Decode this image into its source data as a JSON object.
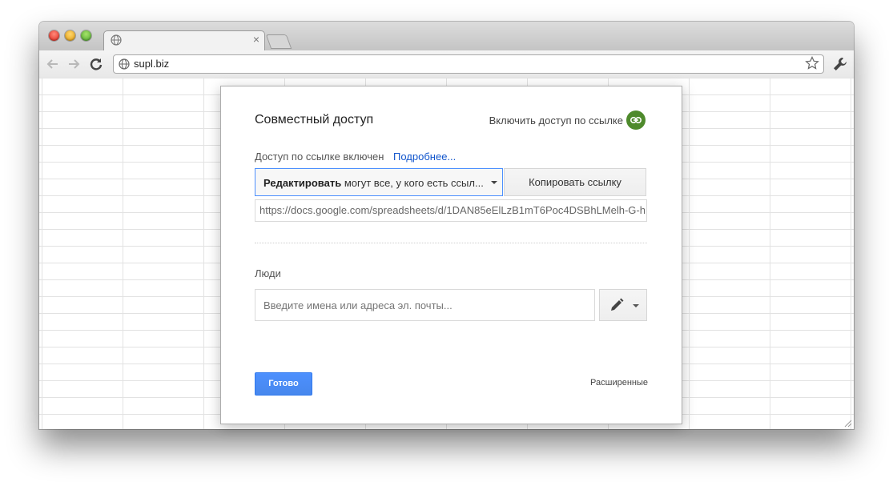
{
  "browser": {
    "address": "supl.biz"
  },
  "dialog": {
    "title": "Совместный доступ",
    "enable_link_label": "Включить доступ по ссылке",
    "link_status": "Доступ по ссылке включен",
    "more_link": "Подробнее...",
    "access_bold": "Редактировать",
    "access_rest": " могут все, у кого есть ссыл...",
    "copy_link_label": "Копировать ссылку",
    "share_url": "https://docs.google.com/spreadsheets/d/1DAN85eElLzB1mT6Poc4DSBhLMelh-G-h",
    "people_label": "Люди",
    "people_placeholder": "Введите имена или адреса эл. почты...",
    "done_label": "Готово",
    "advanced_label": "Расширенные"
  },
  "colors": {
    "accent_blue": "#4d90fe",
    "link_green": "#4e8a2c",
    "link_text": "#1155cc"
  },
  "icons": [
    "globe-icon",
    "close-icon",
    "back-arrow-icon",
    "forward-arrow-icon",
    "reload-icon",
    "star-icon",
    "wrench-icon",
    "link-icon",
    "pencil-icon",
    "chevron-down-icon"
  ]
}
